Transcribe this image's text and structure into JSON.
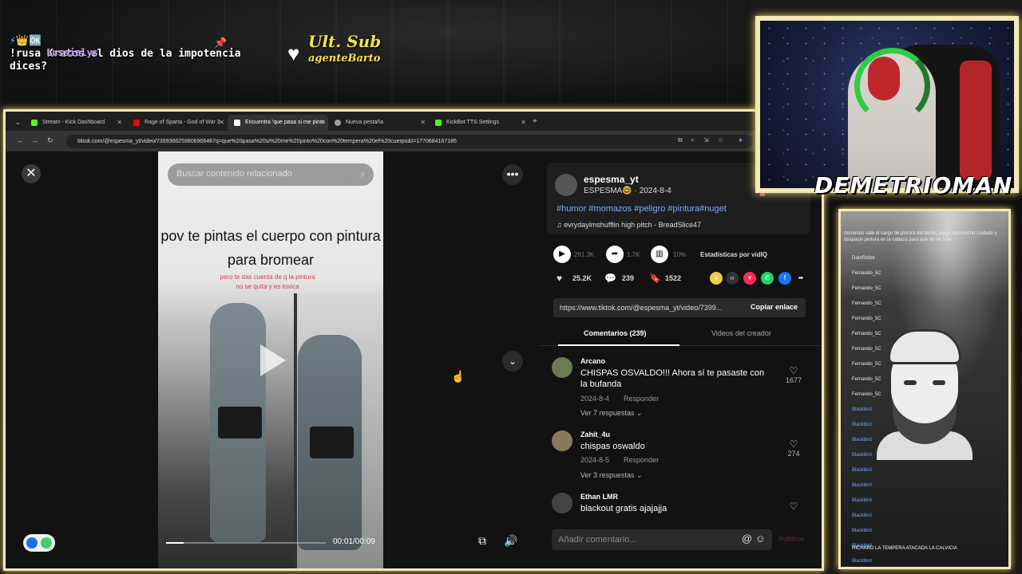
{
  "overlay": {
    "chat_badges": "⚡👑🆗",
    "chat_user": "Lussialys",
    "chat_message": "!rusa Kratos el dios de la impotencia dices?",
    "ult_sub_label": "Ult. Sub",
    "ult_sub_name": "agenteBarto",
    "streamer_name": "DEMETRIOMAN"
  },
  "browser": {
    "tabs": [
      {
        "label": "Stream - Kick Dashboard",
        "color": "#53fc18"
      },
      {
        "label": "Rage of Sparta - God of War 3",
        "color": "#ff0000"
      },
      {
        "label": "Encuentra 'que pasa si me pinto",
        "color": "#ffffff"
      },
      {
        "label": "Nueva pestaña",
        "color": "#9aa0a6"
      },
      {
        "label": "KickBot TTS Settings",
        "color": "#53fc18"
      }
    ],
    "url": "tiktok.com/@espesma_yt/video/7399366259806966467q=que%20pasa%20si%20me%20pinto%20con%20tempera%20el%20cuerpo&t=1770684167185"
  },
  "video": {
    "search_placeholder": "Buscar contenido relacionado",
    "title": "pov te pintas el cuerpo con pintura para bromear",
    "subtitle": "pero te das cuenta de q la pintura no se quita y es toxica",
    "time": "00:01/00:09",
    "progress_percent": 11
  },
  "post": {
    "username": "espesma_yt",
    "sub": "ESPESMA🤓 · 2024-8-4",
    "hashtags": "#humor #momazos #peligro #pintura#nuget",
    "music": "♫  evrydayimshufflin high pitch - BreadSlice47",
    "plays": "281.3K",
    "shares_top": "1.7K",
    "ratio": "10%",
    "stats_label": "Estadísticas por vidIQ",
    "likes": "25.2K",
    "comments": "239",
    "saves": "1522",
    "link": "https://www.tiktok.com/@espesma_yt/video/7399...",
    "copy_label": "Copiar enlace",
    "tab_comments": "Comentarios (239)",
    "tab_creator": "Videos del creador"
  },
  "comments": [
    {
      "name": "Arcano",
      "text": "CHISPAS OSVALDO!!! Ahora sí te pasaste con la bufanda",
      "date": "2024-8-4",
      "reply": "Responder",
      "likes": "1677",
      "more": "Ver 7 respuestas"
    },
    {
      "name": "Zahit_4u",
      "text": "chispas oswaldo",
      "date": "2024-8-5",
      "reply": "Responder",
      "likes": "274",
      "more": "Ver 3 respuestas"
    },
    {
      "name": "Ethan LMR",
      "text": "blackout gratis ajajajja",
      "date": "",
      "reply": "",
      "likes": "",
      "more": ""
    }
  ],
  "composer": {
    "placeholder": "Añadir comentario...",
    "publish": "Publicar"
  },
  "side_chat": {
    "first_line": "tremendo sale el cargo de pintura del techo, luego con mucho cuidado y despacio pintura en la cabeza para que no se note",
    "users": [
      "DatoRobot",
      "Fernando_5C",
      "Fernando_5C",
      "Fernando_5C",
      "Fernando_5C",
      "Fernando_5C",
      "Fernando_5C",
      "Fernando_5C",
      "Fernando_5C",
      "Fernando_5C",
      "Blackbird",
      "Blackbird",
      "Blackbird",
      "Blackbird",
      "Blackbird",
      "Blackbird",
      "Blackbird",
      "Blackbird",
      "Blackbird",
      "Blackbird",
      "Blackbird"
    ],
    "last_message": "RICHARD LA TEMPERA ATACADA LA CALVICIA"
  }
}
